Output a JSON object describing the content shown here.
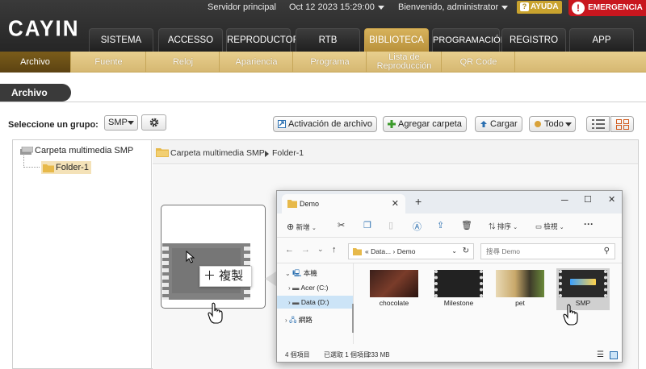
{
  "app": {
    "logo": "CAYIN",
    "server": "Servidor principal",
    "datetime": "Oct 12 2023 15:29:00",
    "welcome": "Bienvenido, administrator",
    "help": "AYUDA",
    "emergency": "EMERGENCIA"
  },
  "main_tabs": [
    "SISTEMA",
    "ACCESSO",
    "REPRODUCTOR",
    "RTB",
    "BIBLIOTECA",
    "PROGRAMACIÓN",
    "REGISTRO",
    "APP"
  ],
  "sub_tabs": [
    "Archivo",
    "Fuente",
    "Reloj",
    "Apariencia",
    "Programa",
    "Lista de Reproducción",
    "QR Code"
  ],
  "page": {
    "title": "Archivo",
    "group_label": "Seleccione un grupo:",
    "group_value": "SMP",
    "buttons": {
      "activation": "Activación de archivo",
      "add_folder": "Agregar carpeta",
      "upload": "Cargar",
      "filter": "Todo"
    }
  },
  "tree": {
    "root": "Carpeta multimedia SMP",
    "folder": "Folder-1"
  },
  "breadcrumb": [
    "Carpeta multimedia SMP",
    "Folder-1"
  ],
  "drag": {
    "tooltip": "＋ 複製"
  },
  "explorer": {
    "tab_title": "Demo",
    "commands": {
      "new": "新增",
      "sort": "排序",
      "view": "檢視"
    },
    "address": [
      "«",
      "Data...",
      "›",
      "Demo"
    ],
    "search_placeholder": "搜尋 Demo",
    "nav": {
      "this_pc": "本機",
      "c_drive": "Acer (C:)",
      "d_drive": "Data (D:)",
      "network": "網路"
    },
    "files": [
      "chocolate",
      "Milestone",
      "pet",
      "SMP"
    ],
    "status": {
      "count": "4 個項目",
      "selected": "已選取 1 個項目",
      "size": "233 MB"
    }
  },
  "colors": {
    "header_dark": "#2a2a2a",
    "gold": "#c9a24a",
    "gold_dark": "#6b4f16",
    "emergency": "#c8161e"
  }
}
